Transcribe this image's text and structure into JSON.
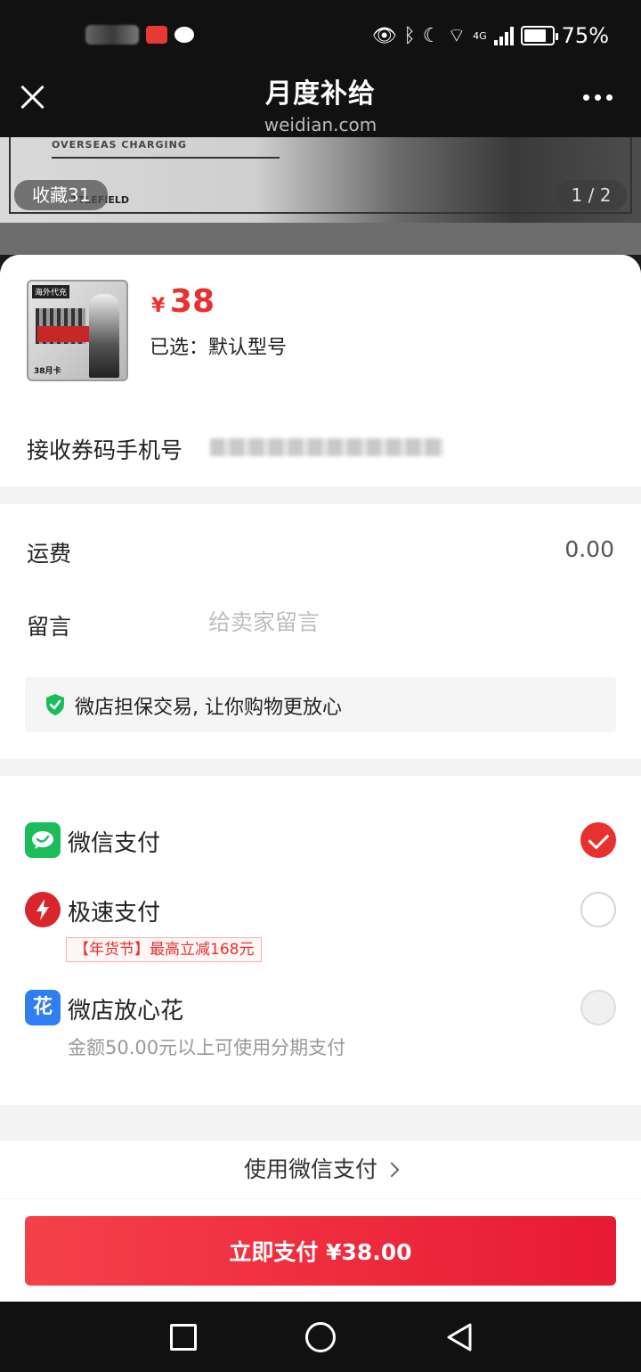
{
  "status_bar": {
    "battery_percent": "75%",
    "network_label": "4G",
    "icons": [
      "eye-icon",
      "bluetooth-icon",
      "moon-icon",
      "wifi-icon",
      "signal-icon",
      "battery-icon"
    ]
  },
  "header": {
    "title": "月度补给",
    "subtitle": "weidian.com"
  },
  "banner": {
    "text_top": "OVERSEAS CHARGING",
    "text_bottom": "TTLEFIELD",
    "favorites": "收藏31",
    "page_indicator": "1 / 2"
  },
  "product": {
    "currency": "¥",
    "price": "38",
    "thumb_logo": "海外代充",
    "thumb_label": "38月卡",
    "selected": "已选：默认型号"
  },
  "form": {
    "phone_label": "接收券码手机号",
    "shipping_label": "运费",
    "shipping_value": "0.00",
    "message_label": "留言",
    "message_placeholder": "给卖家留言",
    "guarantee_text": "微店担保交易, 让你购物更放心"
  },
  "payment": {
    "methods": [
      {
        "label": "微信支付",
        "icon": "wechat-pay-icon",
        "selected": true
      },
      {
        "label": "极速支付",
        "icon": "lightning-icon",
        "selected": false
      },
      {
        "label": "微店放心花",
        "icon": "huabei-icon",
        "icon_text": "花",
        "selected": false
      }
    ],
    "promo": "【年货节】最高立减168元",
    "installment_note": "金额50.00元以上可使用分期支付",
    "switch_label": "使用微信支付",
    "pay_button": "立即支付 ¥38.00"
  },
  "colors": {
    "accent": "#e8302f",
    "wechat_green": "#1bbd5b",
    "fast_pay_red": "#d9262c",
    "huabei_blue": "#2f7ff3"
  }
}
